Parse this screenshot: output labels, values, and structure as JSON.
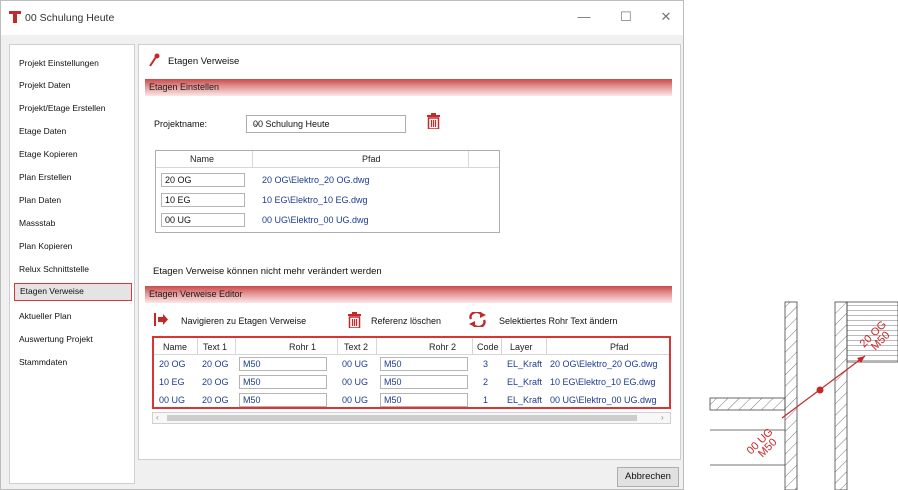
{
  "window": {
    "title": "00 Schulung Heute",
    "buttons": [
      "—",
      "☐",
      "✕"
    ]
  },
  "sidebar": {
    "items": [
      {
        "label": "Projekt Einstellungen"
      },
      {
        "label": "Projekt Daten"
      },
      {
        "label": "Projekt/Etage Erstellen"
      },
      {
        "label": "Etage Daten"
      },
      {
        "label": "Etage Kopieren"
      },
      {
        "label": "Plan Erstellen"
      },
      {
        "label": "Plan Daten"
      },
      {
        "label": "Massstab"
      },
      {
        "label": "Plan Kopieren"
      },
      {
        "label": "Relux Schnittstelle"
      },
      {
        "label": "Etagen Verweise",
        "active": true
      },
      {
        "label": "Aktueller Plan"
      },
      {
        "label": "Auswertung Projekt"
      },
      {
        "label": "Stammdaten"
      }
    ]
  },
  "main": {
    "header": "Etagen Verweise",
    "section1": "Etagen Einstellen",
    "projektname_label": "Projektname:",
    "projektname_value": "00 Schulung Heute",
    "floors_table": {
      "columns": [
        "Name",
        "Pfad"
      ],
      "rows": [
        {
          "name": "20 OG",
          "pfad": "20 OG\\Elektro_20 OG.dwg"
        },
        {
          "name": "10 EG",
          "pfad": "10 EG\\Elektro_10 EG.dwg"
        },
        {
          "name": "00 UG",
          "pfad": "00 UG\\Elektro_00 UG.dwg"
        }
      ]
    },
    "info_text": "Etagen Verweise können nicht mehr verändert werden",
    "section2": "Etagen Verweise Editor",
    "toolbar": {
      "navigate": "Navigieren zu Etagen Verweise",
      "delete": "Referenz löschen",
      "change": "Selektiertes Rohr Text ändern"
    },
    "refs_table": {
      "columns": [
        "Name",
        "Text 1",
        "Rohr 1",
        "Text 2",
        "Rohr 2",
        "Code",
        "Layer",
        "Pfad"
      ],
      "rows": [
        {
          "name": "20 OG",
          "text1": "20 OG",
          "rohr1": "M50",
          "text2": "00 UG",
          "rohr2": "M50",
          "code": "3",
          "layer": "EL_Kraft",
          "pfad": "20 OG\\Elektro_20 OG.dwg"
        },
        {
          "name": "10 EG",
          "text1": "20 OG",
          "rohr1": "M50",
          "text2": "00 UG",
          "rohr2": "M50",
          "code": "2",
          "layer": "EL_Kraft",
          "pfad": "10 EG\\Elektro_10 EG.dwg"
        },
        {
          "name": "00 UG",
          "text1": "20 OG",
          "rohr1": "M50",
          "text2": "00 UG",
          "rohr2": "M50",
          "code": "1",
          "layer": "EL_Kraft",
          "pfad": "00 UG\\Elektro_00 UG.dwg"
        }
      ]
    },
    "cancel_button": "Abbrechen"
  },
  "drawing": {
    "label_top_1": "20 OG",
    "label_top_2": "M50",
    "label_bottom_1": "00 UG",
    "label_bottom_2": "M50"
  },
  "colors": {
    "accent": "#d83535",
    "link": "#1d3c8f"
  }
}
